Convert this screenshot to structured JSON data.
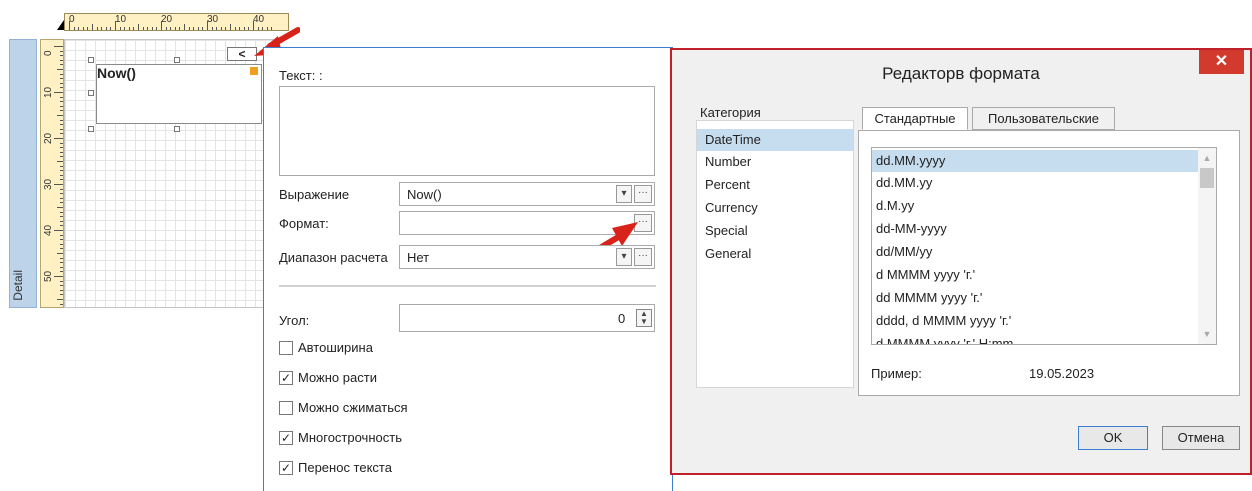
{
  "designer": {
    "band_label": "Detail",
    "hruler_labels": [
      "0",
      "10",
      "20",
      "30",
      "40"
    ],
    "vruler_labels": [
      "0",
      "10",
      "20",
      "30",
      "40",
      "50"
    ],
    "textbox_value": "Now()",
    "collapse_glyph": "<"
  },
  "properties": {
    "text_label": "Текст: :",
    "text_value": "",
    "expression_label": "Выражение",
    "expression_value": "Now()",
    "format_label": "Формат:",
    "format_value": "",
    "range_label": "Диапазон расчета",
    "range_value": "Нет",
    "angle_label": "Угол:",
    "angle_value": "0",
    "checkboxes": [
      {
        "label": "Автоширина",
        "checked": false
      },
      {
        "label": "Можно расти",
        "checked": true
      },
      {
        "label": "Можно сжиматься",
        "checked": false
      },
      {
        "label": "Многострочность",
        "checked": true
      },
      {
        "label": "Перенос текста",
        "checked": true
      }
    ]
  },
  "dialog": {
    "title": "Редакторв формата",
    "close_glyph": "✕",
    "category_label": "Категория",
    "categories": [
      "DateTime",
      "Number",
      "Percent",
      "Currency",
      "Special",
      "General"
    ],
    "selected_category": "DateTime",
    "tabs": [
      "Стандартные",
      "Пользовательские"
    ],
    "active_tab": "Стандартные",
    "formats": [
      "dd.MM.yyyy",
      "dd.MM.yy",
      "d.M.yy",
      "dd-MM-yyyy",
      "dd/MM/yy",
      "d MMMM yyyy 'г.'",
      "dd MMMM yyyy 'г.'",
      "dddd, d MMMM yyyy 'г.'",
      "d MMMM yyyy 'г.' H:mm"
    ],
    "selected_format": "dd.MM.yyyy",
    "example_label": "Пример:",
    "example_value": "19.05.2023",
    "ok_label": "OK",
    "cancel_label": "Отмена"
  },
  "colors": {
    "accent": "#3c7fd0",
    "dialog_border": "#c0202a",
    "close_button": "#d23a2e",
    "selection": "#c6ddf0",
    "arrow": "#d8231a"
  }
}
